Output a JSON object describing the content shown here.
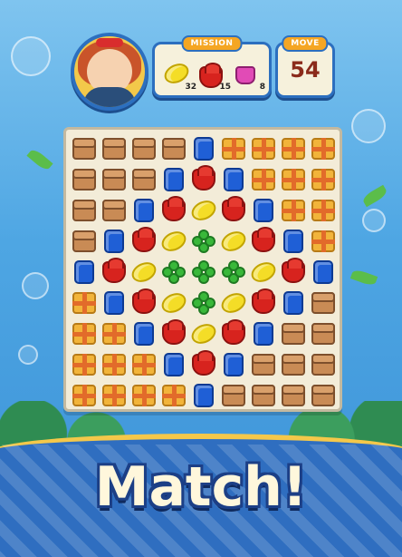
{
  "header": {
    "mission_label": "MISSION",
    "move_label": "MOVE",
    "moves_left": "54",
    "mission_goals": [
      {
        "icon": "lemon-icon",
        "count": "32"
      },
      {
        "icon": "rose-icon",
        "count": "15"
      },
      {
        "icon": "pink-bag-icon",
        "count": "8"
      }
    ]
  },
  "board": {
    "rows": [
      [
        "box",
        "box",
        "box",
        "box",
        "blue",
        "gift",
        "gift",
        "gift",
        "gift"
      ],
      [
        "box",
        "box",
        "box",
        "blue",
        "rose",
        "blue",
        "gift",
        "gift",
        "gift"
      ],
      [
        "box",
        "box",
        "blue",
        "rose",
        "lemon",
        "rose",
        "blue",
        "gift",
        "gift"
      ],
      [
        "box",
        "blue",
        "rose",
        "lemon",
        "clover",
        "lemon",
        "rose",
        "blue",
        "gift"
      ],
      [
        "blue",
        "rose",
        "lemon",
        "clover",
        "clover",
        "clover",
        "lemon",
        "rose",
        "blue"
      ],
      [
        "gift",
        "blue",
        "rose",
        "lemon",
        "clover",
        "lemon",
        "rose",
        "blue",
        "box"
      ],
      [
        "gift",
        "gift",
        "blue",
        "rose",
        "lemon",
        "rose",
        "blue",
        "box",
        "box"
      ],
      [
        "gift",
        "gift",
        "gift",
        "blue",
        "rose",
        "blue",
        "box",
        "box",
        "box"
      ],
      [
        "gift",
        "gift",
        "gift",
        "gift",
        "blue",
        "box",
        "box",
        "box",
        "box"
      ]
    ]
  },
  "banner": {
    "text": "Match!"
  },
  "colors": {
    "accent": "#2c6fbf",
    "banner_border": "#f4c84a",
    "move_text": "#8b2b1b"
  }
}
